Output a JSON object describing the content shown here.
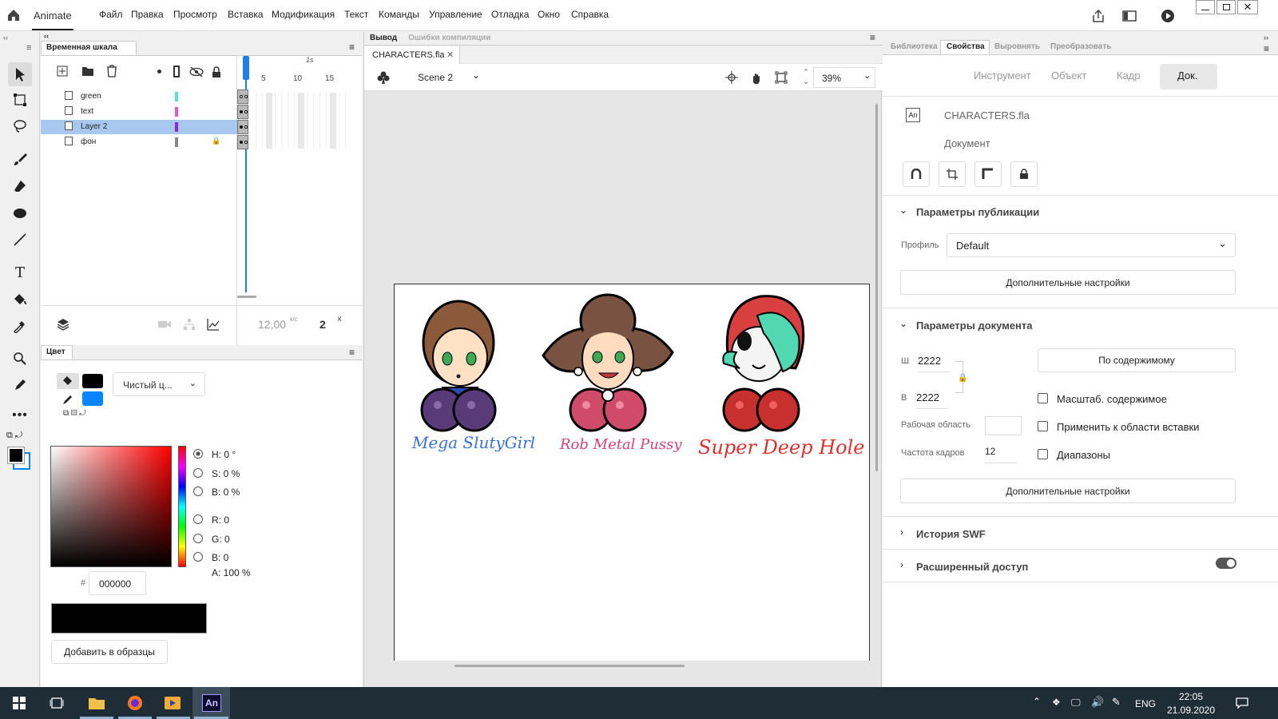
{
  "app": {
    "name": "Animate"
  },
  "menu": [
    "Файл",
    "Правка",
    "Просмотр",
    "Вставка",
    "Модификация",
    "Текст",
    "Команды",
    "Управление",
    "Отладка",
    "Окно",
    "Справка"
  ],
  "timeline": {
    "title": "Временная шкала",
    "ruler": {
      "seconds_label": "1s",
      "ticks": [
        "5",
        "10",
        "15"
      ]
    },
    "layers": [
      {
        "name": "green",
        "color": "#55e0e0",
        "selected": false,
        "locked": false
      },
      {
        "name": "text",
        "color": "#e055e0",
        "selected": false,
        "locked": false
      },
      {
        "name": "Layer 2",
        "color": "#8a2be2",
        "selected": true,
        "locked": false
      },
      {
        "name": "фон",
        "color": "#888888",
        "selected": false,
        "locked": true
      }
    ],
    "fps": "12,00",
    "fps_unit": "к/с",
    "frame": "2",
    "frame_unit": "К"
  },
  "color_panel": {
    "title": "Цвет",
    "fill_type": "Чистый ц...",
    "stroke_color": "#000000",
    "fill_color": "#0a84ff",
    "hsb": {
      "h": "H: 0 °",
      "s": "S: 0 %",
      "b": "B: 0 %"
    },
    "rgb": {
      "r": "R: 0",
      "g": "G: 0",
      "b": "B: 0"
    },
    "alpha": "A: 100 %",
    "hash": "#",
    "hex": "000000",
    "add_swatch": "Добавить в образцы"
  },
  "stage": {
    "tabs": [
      "Вывод",
      "Ошибки компиляции"
    ],
    "doc_tab": "CHARACTERS.fla",
    "scene": "Scene 2",
    "zoom": "39%",
    "captions": [
      "Mega SlutyGirl",
      "Rob Metal Pussy",
      "Super Deep Hole"
    ],
    "caption_colors": [
      "#3a6fd8",
      "#d8407a",
      "#e03030"
    ]
  },
  "properties": {
    "tabs": [
      "Библиотека",
      "Свойства",
      "Выровнять",
      "Преобразовать"
    ],
    "subtabs": [
      "Инструмент",
      "Объект",
      "Кадр",
      "Док."
    ],
    "file_name": "CHARACTERS.fla",
    "file_badge": "An",
    "doc_label": "Документ",
    "publish_section": "Параметры публикации",
    "profile_label": "Профиль",
    "profile_value": "Default",
    "more_settings": "Дополнительные настройки",
    "doc_section": "Параметры документа",
    "width_label": "Ш",
    "width": "2222",
    "height_label": "В",
    "height": "2222",
    "fit_content": "По содержимому",
    "scale_content": "Масштаб. содержимое",
    "apply_paste": "Применить к области вставки",
    "ranges": "Диапазоны",
    "stage_label": "Рабочая область",
    "fps_label": "Частота кадров",
    "fps_value": "12",
    "more_settings2": "Дополнительные настройки",
    "swf_history": "История SWF",
    "advanced_access": "Расширенный доступ"
  },
  "taskbar": {
    "lang": "ENG",
    "time": "22:05",
    "date": "21.09.2020",
    "an_label": "An"
  }
}
